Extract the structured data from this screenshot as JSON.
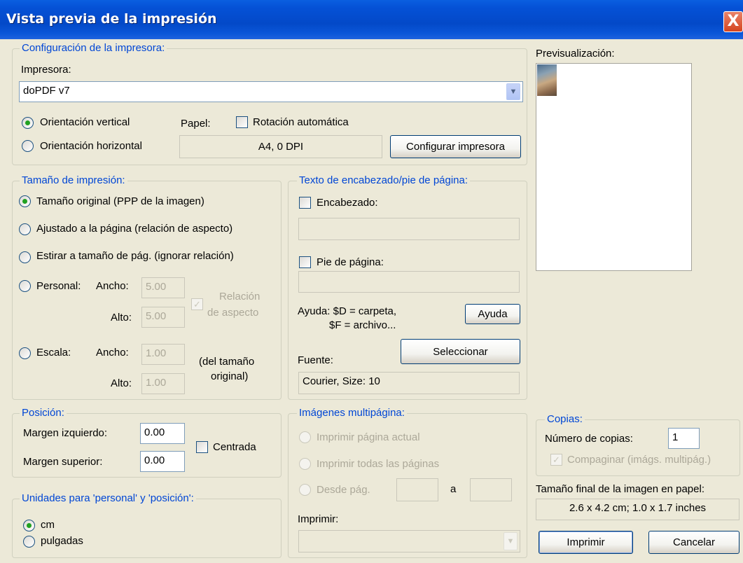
{
  "window": {
    "title": "Vista previa de la impresión",
    "close_glyph": "X"
  },
  "printer": {
    "legend": "Configuración de la impresora:",
    "label": "Impresora:",
    "selected": "doPDF v7",
    "orient_vertical": "Orientación vertical",
    "orient_horizontal": "Orientación horizontal",
    "paper_label": "Papel:",
    "auto_rotation": "Rotación automática",
    "paper_info": "A4,    0 DPI",
    "configure_button": "Configurar impresora"
  },
  "print_size": {
    "legend": "Tamaño de impresión:",
    "original": "Tamaño original (PPP de la imagen)",
    "fit_page": "Ajustado a la página (relación de aspecto)",
    "stretch": "Estirar a tamaño de pág. (ignorar relación)",
    "custom": "Personal:",
    "width_label": "Ancho:",
    "height_label": "Alto:",
    "custom_width": "5.00",
    "custom_height": "5.00",
    "aspect_line1": "Relación",
    "aspect_line2": "de aspecto",
    "scale": "Escala:",
    "scale_width": "1.00",
    "scale_height": "1.00",
    "scale_note_line1": "(del tamaño",
    "scale_note_line2": "original)"
  },
  "header_footer": {
    "legend": "Texto de encabezado/pie de página:",
    "header_label": "Encabezado:",
    "header_value": "",
    "footer_label": "Pie de página:",
    "footer_value": "",
    "help_line1": "Ayuda: $D = carpeta,",
    "help_line2": "$F = archivo...",
    "help_button": "Ayuda",
    "font_label": "Fuente:",
    "select_button": "Seleccionar",
    "font_value": "Courier, Size: 10"
  },
  "preview": {
    "label": "Previsualización:"
  },
  "position": {
    "legend": "Posición:",
    "left_margin_label": "Margen izquierdo:",
    "left_margin": "0.00",
    "top_margin_label": "Margen superior:",
    "top_margin": "0.00",
    "centered": "Centrada"
  },
  "units": {
    "legend": "Unidades para 'personal' y 'posición':",
    "cm": "cm",
    "inches": "pulgadas"
  },
  "multipage": {
    "legend": "Imágenes multipágina:",
    "current": "Imprimir página actual",
    "all": "Imprimir todas las páginas",
    "from": "Desde pág.",
    "to": "a",
    "from_value": "",
    "to_value": "",
    "print_label": "Imprimir:",
    "print_value": ""
  },
  "copies": {
    "legend": "Copias:",
    "count_label": "Número de copias:",
    "count": "1",
    "collate": "Compaginar (imágs. multipág.)"
  },
  "final_size": {
    "label": "Tamaño final de la imagen en papel:",
    "value": "2.6 x 4.2 cm; 1.0 x 1.7 inches"
  },
  "actions": {
    "print": "Imprimir",
    "cancel": "Cancelar"
  },
  "colors": {
    "accent": "#0046d5",
    "titlebar": "#0551d6",
    "dialog_bg": "#ece9d8",
    "radio_dot": "#21a121"
  }
}
